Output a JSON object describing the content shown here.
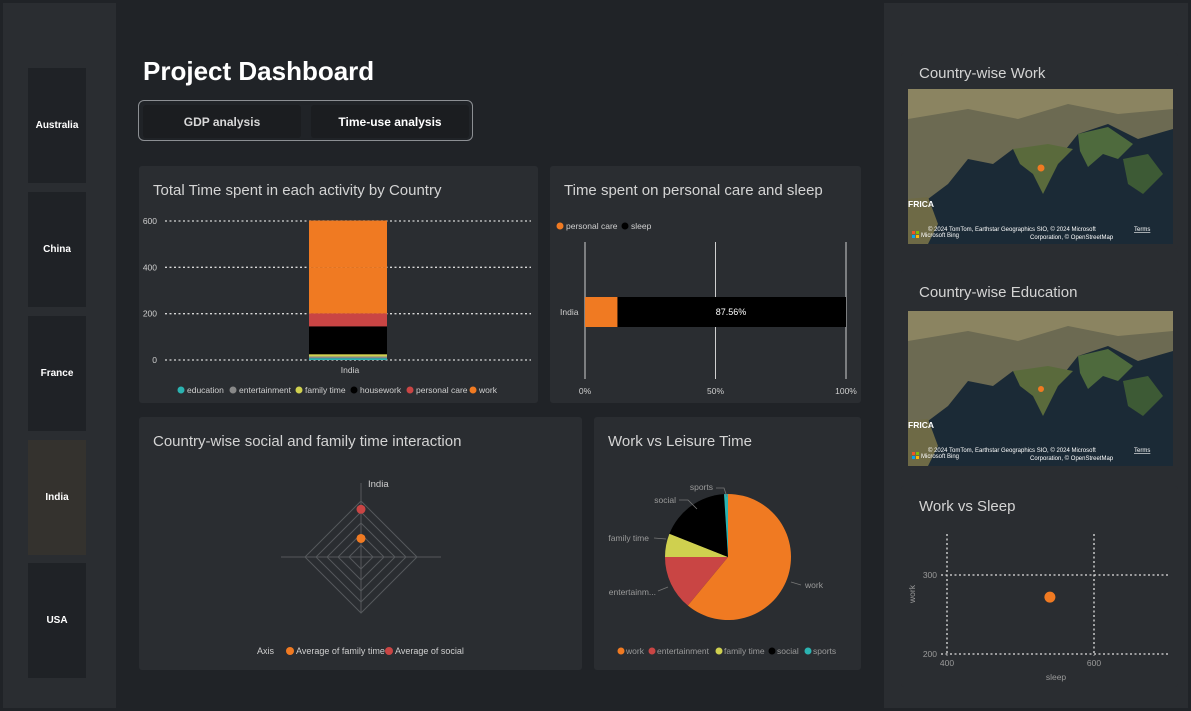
{
  "slicer": {
    "items": [
      "Australia",
      "China",
      "France",
      "India",
      "USA"
    ],
    "selected": "India"
  },
  "header": {
    "title": "Project Dashboard"
  },
  "tabs": [
    {
      "label": "GDP analysis"
    },
    {
      "label": "Time-use analysis"
    }
  ],
  "colors": {
    "education": "#2bb3b1",
    "entertainment": "#888888",
    "family_time": "#cfd04f",
    "housework": "#000000",
    "personal_care": "#c94544",
    "work": "#f07a22",
    "sleep": "#000000"
  },
  "stacked": {
    "title": "Total Time spent in each activity by Country",
    "legend": [
      "education",
      "entertainment",
      "family time",
      "housework",
      "personal care",
      "work"
    ]
  },
  "care": {
    "title": "Time spent on personal care and sleep",
    "legend": [
      "personal care",
      "sleep"
    ],
    "bar_label": "87.56%"
  },
  "radar": {
    "title": "Country-wise social and family time interaction",
    "axis_label": "India",
    "legend_axis": "Axis",
    "legend": [
      "Average of family time",
      "Average of social"
    ]
  },
  "pie": {
    "title": "Work vs Leisure Time",
    "labels": [
      "sports",
      "social",
      "family time",
      "entertainm...",
      "work"
    ],
    "legend": [
      "work",
      "entertainment",
      "family time",
      "social",
      "sports"
    ]
  },
  "maps": [
    {
      "title": "Country-wise Work",
      "region_label": "FRICA",
      "attribution_line1": "© 2024 TomTom, Earthstar Geographics SIO, © 2024 Microsoft",
      "attribution_terms": "Terms",
      "attribution_line2": "Corporation, © OpenStreetMap",
      "brand": "Microsoft Bing"
    },
    {
      "title": "Country-wise Education",
      "region_label": "FRICA",
      "attribution_line1": "© 2024 TomTom, Earthstar Geographics SIO, © 2024 Microsoft",
      "attribution_terms": "Terms",
      "attribution_line2": "Corporation, © OpenStreetMap",
      "brand": "Microsoft Bing"
    }
  ],
  "scatter": {
    "title": "Work vs Sleep"
  },
  "chart_data": [
    {
      "type": "bar",
      "stacked": true,
      "title": "Total Time spent in each activity by Country",
      "categories": [
        "India"
      ],
      "series": [
        {
          "name": "education",
          "values": [
            8
          ]
        },
        {
          "name": "entertainment",
          "values": [
            7
          ]
        },
        {
          "name": "family time",
          "values": [
            10
          ]
        },
        {
          "name": "housework",
          "values": [
            120
          ]
        },
        {
          "name": "personal care",
          "values": [
            56
          ]
        },
        {
          "name": "work",
          "values": [
            200
          ]
        },
        {
          "name": "",
          "values": [
            201
          ]
        }
      ],
      "yticks": [
        "0",
        "200",
        "400",
        "600"
      ],
      "ylim": [
        0,
        600
      ],
      "grid": true,
      "legend_position": "bottom"
    },
    {
      "type": "bar",
      "orientation": "horizontal",
      "stacked_percent": true,
      "title": "Time spent on personal care and sleep",
      "categories": [
        "India"
      ],
      "series": [
        {
          "name": "personal care",
          "values": [
            12.44
          ]
        },
        {
          "name": "sleep",
          "values": [
            87.56
          ]
        }
      ],
      "xticks": [
        "0%",
        "50%",
        "100%"
      ],
      "legend_position": "top-left"
    },
    {
      "type": "radar",
      "title": "Country-wise social and family time interaction",
      "categories": [
        "India"
      ],
      "series": [
        {
          "name": "Average of family time",
          "values": [
            0.35
          ]
        },
        {
          "name": "Average of social",
          "values": [
            0.9
          ]
        }
      ]
    },
    {
      "type": "pie",
      "title": "Work vs Leisure Time",
      "categories": [
        "work",
        "entertainment",
        "family time",
        "social",
        "sports"
      ],
      "values": [
        61,
        14,
        6,
        18,
        1
      ]
    },
    {
      "type": "scatter",
      "title": "Work vs Sleep",
      "xlabel": "sleep",
      "ylabel": "work",
      "xticks": [
        "400",
        "600"
      ],
      "yticks": [
        "200",
        "300"
      ],
      "xlim": [
        400,
        600
      ],
      "ylim": [
        200,
        300
      ],
      "points": [
        {
          "x": 540,
          "y": 272
        }
      ]
    }
  ]
}
